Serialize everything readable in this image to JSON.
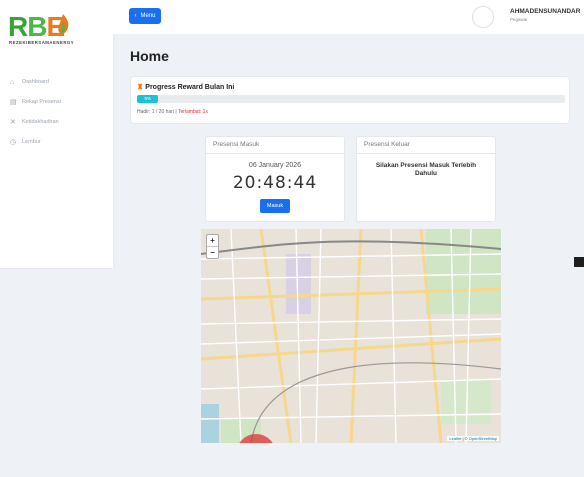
{
  "brand": {
    "logo_letters": "RBE",
    "logo_subtitle": "REZEKIBERSAMAENERGY"
  },
  "sidebar": {
    "items": [
      {
        "label": "Dashboard",
        "icon": "home-icon"
      },
      {
        "label": "Rekap Presensi",
        "icon": "calendar-icon"
      },
      {
        "label": "Ketidakhadiran",
        "icon": "absence-icon"
      },
      {
        "label": "Lembur",
        "icon": "clock-icon"
      }
    ]
  },
  "header": {
    "menu_label": "Menu",
    "user_name": "AHMADENSUNANDAR",
    "user_role": "Pegawai"
  },
  "page": {
    "title": "Home"
  },
  "progress": {
    "title": "Progress Reward Bulan Ini",
    "percent_label": "5%",
    "percent": 5,
    "attendance_text": "Hadir: 1 / 20 hari | ",
    "late_text": "Terlambat: 1x"
  },
  "presensi_masuk": {
    "title": "Presensi Masuk",
    "date": "06 January 2026",
    "time": "20:48:44",
    "button_label": "Masuk"
  },
  "presensi_keluar": {
    "title": "Presensi Keluar",
    "message": "Silakan Presensi Masuk Terlebih Dahulu"
  },
  "map": {
    "zoom_in": "+",
    "zoom_out": "−",
    "attribution_leaflet": "Leaflet",
    "attribution_sep": " | © ",
    "attribution_osm": "OpenStreetMap"
  },
  "colors": {
    "primary": "#1a6ff0",
    "progress": "#1ec0d8",
    "late": "#e03131",
    "brand_green": "#3aa336",
    "brand_orange": "#e87b1c"
  }
}
